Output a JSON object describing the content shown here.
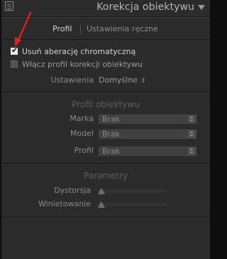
{
  "header": {
    "title": "Korekcja obiektywu"
  },
  "tabs": [
    {
      "label": "Profil",
      "active": true
    },
    {
      "label": "Ustawienia ręczne",
      "active": false
    }
  ],
  "checkboxes": {
    "remove_ca": {
      "label": "Usuń aberację chromatyczną",
      "checked": true
    },
    "enable_profile": {
      "label": "Włącz profil korekcji obiektywu",
      "checked": false
    }
  },
  "setup": {
    "label": "Ustawienia",
    "value": "Domyślne"
  },
  "profile": {
    "title": "Profil obiektywu",
    "fields": [
      {
        "label": "Marka",
        "value": "Brak"
      },
      {
        "label": "Model",
        "value": "Brak"
      },
      {
        "label": "Profil",
        "value": "Brak"
      }
    ]
  },
  "parameters": {
    "title": "Parametry",
    "sliders": [
      {
        "label": "Dystorsja",
        "value": 0
      },
      {
        "label": "Winietowanie",
        "value": 0
      }
    ]
  },
  "colors": {
    "annotation_arrow": "#e02020",
    "panel_bg": "#2b2b2b"
  },
  "icons": {
    "check": "✔",
    "collapse": "triangle-down-icon",
    "grip": "panel-grip-icon",
    "updown": "⇕"
  }
}
